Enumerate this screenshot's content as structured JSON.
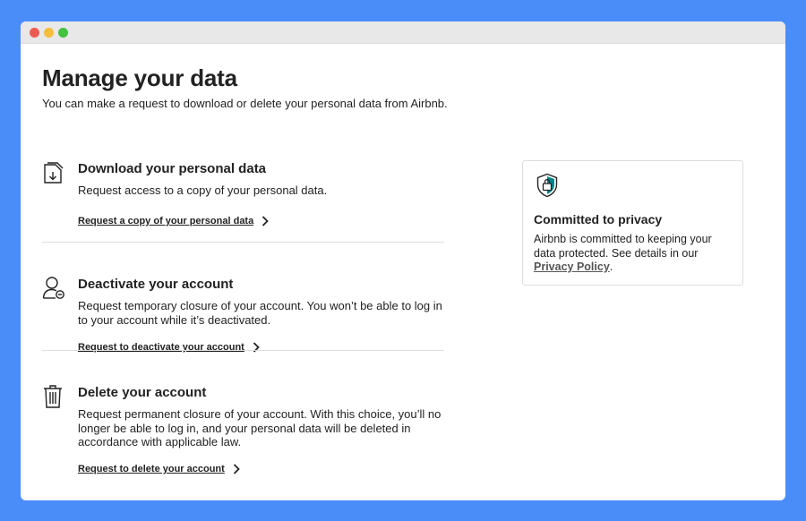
{
  "page": {
    "title": "Manage your data",
    "subtitle": "You can make a request to download or delete your personal data from Airbnb."
  },
  "sections": [
    {
      "icon": "document-download-icon",
      "title": "Download your personal data",
      "description": "Request access to a copy of your personal data.",
      "link": "Request a copy of your personal data"
    },
    {
      "icon": "user-minus-icon",
      "title": "Deactivate your account",
      "description": "Request temporary closure of your account. You won’t be able to log in to your account while it’s deactivated.",
      "link": "Request to deactivate your account"
    },
    {
      "icon": "trash-icon",
      "title": "Delete your account",
      "description": "Request permanent closure of your account. With this choice, you’ll no longer be able to log in, and your personal data will be deleted in accordance with applicable law.",
      "link": "Request to delete your account"
    }
  ],
  "privacy": {
    "icon": "shield-lock-icon",
    "title": "Committed to privacy",
    "text": "Airbnb is committed to keeping your data protected. See details in our ",
    "link": "Privacy Policy",
    "suffix": "."
  },
  "colors": {
    "background": "#4B8DF8",
    "text": "#222222",
    "divider": "#dddddd",
    "shield_accent": "#008489"
  }
}
